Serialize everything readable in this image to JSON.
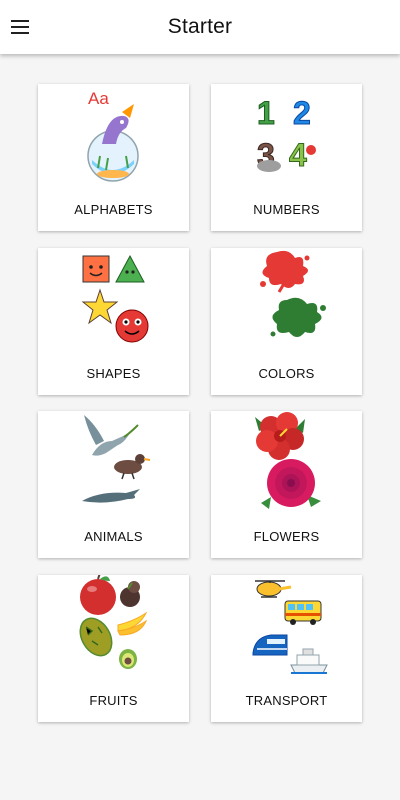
{
  "app_bar": {
    "title": "Starter",
    "menu_icon": "hamburger-menu-icon"
  },
  "categories": [
    {
      "id": "alphabets",
      "label": "ALPHABETS",
      "glyph": "Aa"
    },
    {
      "id": "numbers",
      "label": "NUMBERS",
      "digits": [
        "1",
        "2",
        "3",
        "4"
      ]
    },
    {
      "id": "shapes",
      "label": "SHAPES"
    },
    {
      "id": "colors",
      "label": "COLORS"
    },
    {
      "id": "animals",
      "label": "ANIMALS"
    },
    {
      "id": "flowers",
      "label": "FLOWERS"
    },
    {
      "id": "fruits",
      "label": "FRUITS"
    },
    {
      "id": "transport",
      "label": "TRANSPORT"
    }
  ],
  "colors": {
    "background": "#f5f5f5",
    "card": "#ffffff",
    "text": "#111111"
  }
}
